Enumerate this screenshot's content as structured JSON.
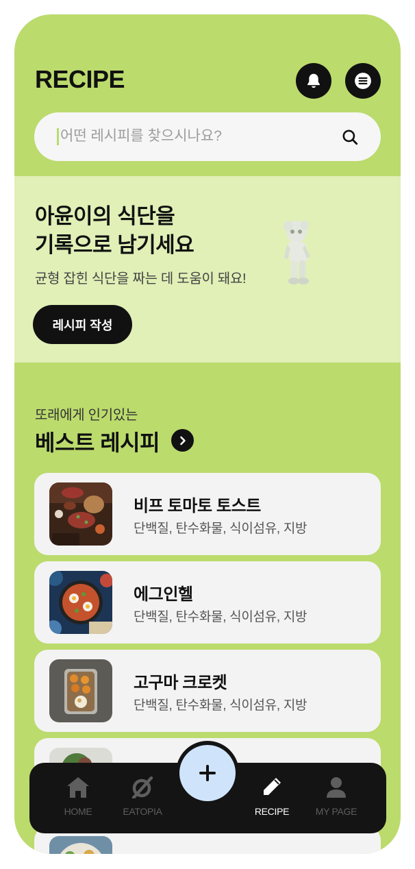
{
  "header": {
    "title": "RECIPE"
  },
  "search": {
    "placeholder": "어떤 레시피를 찾으시나요?"
  },
  "banner": {
    "title_line1": "아윤이의 식단을",
    "title_line2": "기록으로 남기세요",
    "subtitle": "균형 잡힌 식단을 짜는 데 도움이 돼요!",
    "button_label": "레시피 작성"
  },
  "best": {
    "subtitle": "또래에게 인기있는",
    "title": "베스트 레시피"
  },
  "recipes": [
    {
      "title": "비프 토마토 토스트",
      "desc": "단백질, 탄수화물, 식이섬유, 지방"
    },
    {
      "title": "에그인헬",
      "desc": "단백질, 탄수화물, 식이섬유, 지방"
    },
    {
      "title": "고구마 크로켓",
      "desc": "단백질, 탄수화물, 식이섬유, 지방"
    },
    {
      "title": "",
      "desc": ""
    },
    {
      "title": "",
      "desc": ""
    }
  ],
  "nav": {
    "items": [
      {
        "label": "HOME",
        "icon": "home-icon"
      },
      {
        "label": "EATOPIA",
        "icon": "eatopia-icon"
      },
      {
        "label": "RECIPE",
        "icon": "pencil-icon"
      },
      {
        "label": "MY PAGE",
        "icon": "person-icon"
      }
    ],
    "active": "RECIPE",
    "fab_icon": "plus-icon"
  },
  "colors": {
    "background": "#bbdb6d",
    "banner": "#e0f0b7",
    "card": "#f3f3f3",
    "dark": "#111111",
    "fab": "#cfe4fb"
  }
}
